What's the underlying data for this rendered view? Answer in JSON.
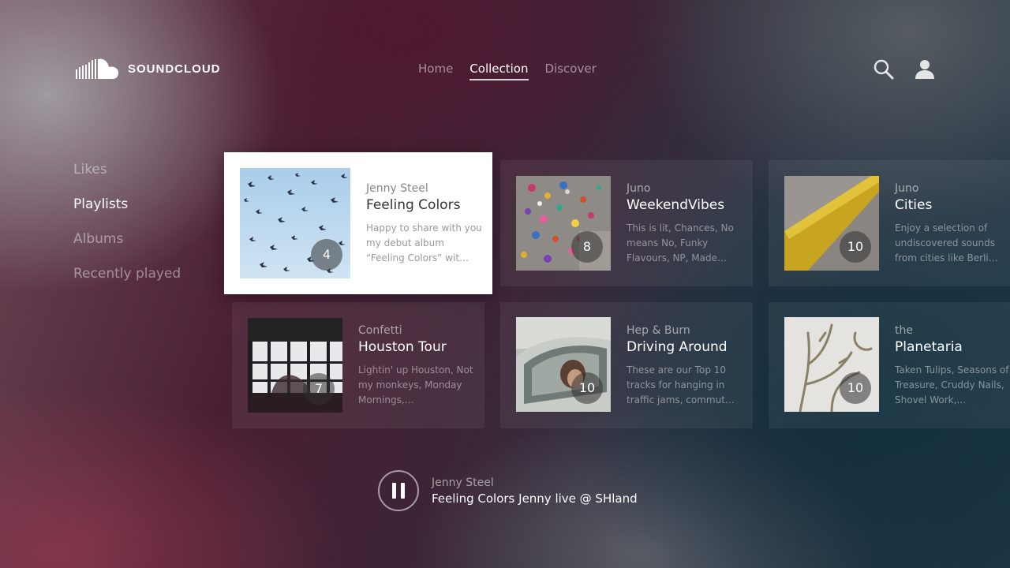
{
  "app": {
    "brand": "SOUNDCLOUD"
  },
  "nav": {
    "items": [
      {
        "label": "Home",
        "active": false
      },
      {
        "label": "Collection",
        "active": true
      },
      {
        "label": "Discover",
        "active": false
      }
    ]
  },
  "header": {
    "search_icon": "search-icon",
    "profile_icon": "user-icon"
  },
  "sidebar": {
    "items": [
      {
        "label": "Likes",
        "active": false
      },
      {
        "label": "Playlists",
        "active": true
      },
      {
        "label": "Albums",
        "active": false
      },
      {
        "label": "Recently played",
        "active": false
      }
    ]
  },
  "playlists": [
    {
      "artist": "Jenny Steel",
      "title": "Feeling Colors",
      "count": "4",
      "description": "Happy to share with you my debut album “Feeling Colors” wit…",
      "focused": true,
      "art": "birds"
    },
    {
      "artist": "Juno",
      "title": "WeekendVibes",
      "count": "8",
      "description": "This is lit, Chances, No means No,  Funky Flavours, NP, Made…",
      "focused": false,
      "art": "confetti"
    },
    {
      "artist": "Juno",
      "title": "Cities",
      "count": "10",
      "description": "Enjoy a selection of undiscovered sounds from cities like Berli…",
      "focused": false,
      "art": "curb"
    },
    {
      "artist": "Confetti",
      "title": "Houston Tour",
      "count": "7",
      "description": "Lightin' up Houston, Not my monkeys, Monday Mornings,…",
      "focused": false,
      "art": "window"
    },
    {
      "artist": "Hep & Burn",
      "title": "Driving Around",
      "count": "10",
      "description": "These are our Top 10 tracks for hanging in traffic jams, commut…",
      "focused": false,
      "art": "car"
    },
    {
      "artist": "the",
      "title": "Planetaria",
      "count": "10",
      "description": "Taken Tulips, Seasons of Treasure, Cruddy Nails,  Shovel Work,…",
      "focused": false,
      "art": "branches"
    }
  ],
  "now_playing": {
    "artist": "Jenny Steel",
    "title": "Feeling Colors Jenny live @ SHland",
    "state": "playing"
  }
}
